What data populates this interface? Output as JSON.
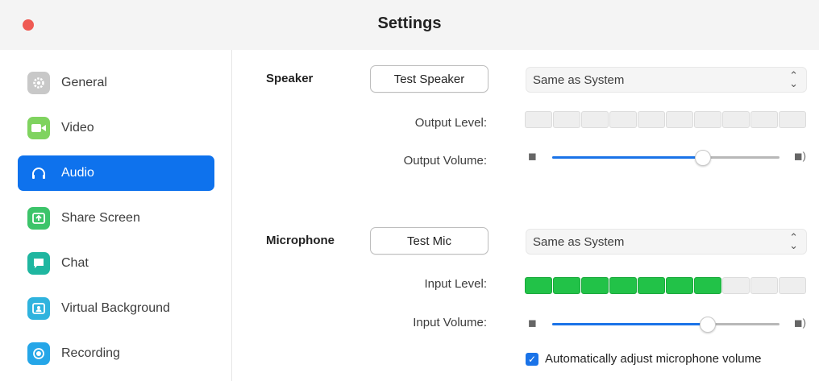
{
  "window": {
    "title": "Settings"
  },
  "sidebar": {
    "items": [
      {
        "label": "General",
        "icon": "gear-icon",
        "color": "#c8c8c8",
        "active": false
      },
      {
        "label": "Video",
        "icon": "video-camera-icon",
        "color": "#7fd35f",
        "active": false
      },
      {
        "label": "Audio",
        "icon": "headphones-icon",
        "color": "#0e72ed",
        "active": true
      },
      {
        "label": "Share Screen",
        "icon": "share-screen-icon",
        "color": "#3cc46a",
        "active": false
      },
      {
        "label": "Chat",
        "icon": "chat-bubble-icon",
        "color": "#1fb6a0",
        "active": false
      },
      {
        "label": "Virtual Background",
        "icon": "person-portrait-icon",
        "color": "#2fb3de",
        "active": false
      },
      {
        "label": "Recording",
        "icon": "record-icon",
        "color": "#25a6e8",
        "active": false
      }
    ]
  },
  "speaker": {
    "section_label": "Speaker",
    "test_button": "Test Speaker",
    "device": "Same as System",
    "output_level_label": "Output Level:",
    "output_level": 0,
    "output_volume_label": "Output Volume:",
    "output_volume": 0.66
  },
  "microphone": {
    "section_label": "Microphone",
    "test_button": "Test Mic",
    "device": "Same as System",
    "input_level_label": "Input Level:",
    "input_level": 0.7,
    "input_volume_label": "Input Volume:",
    "input_volume": 0.68,
    "auto_adjust_label": "Automatically adjust microphone volume",
    "auto_adjust": true
  },
  "colors": {
    "accent": "#0e72ed",
    "meter_on": "#22c248",
    "close": "#ef5a53"
  }
}
